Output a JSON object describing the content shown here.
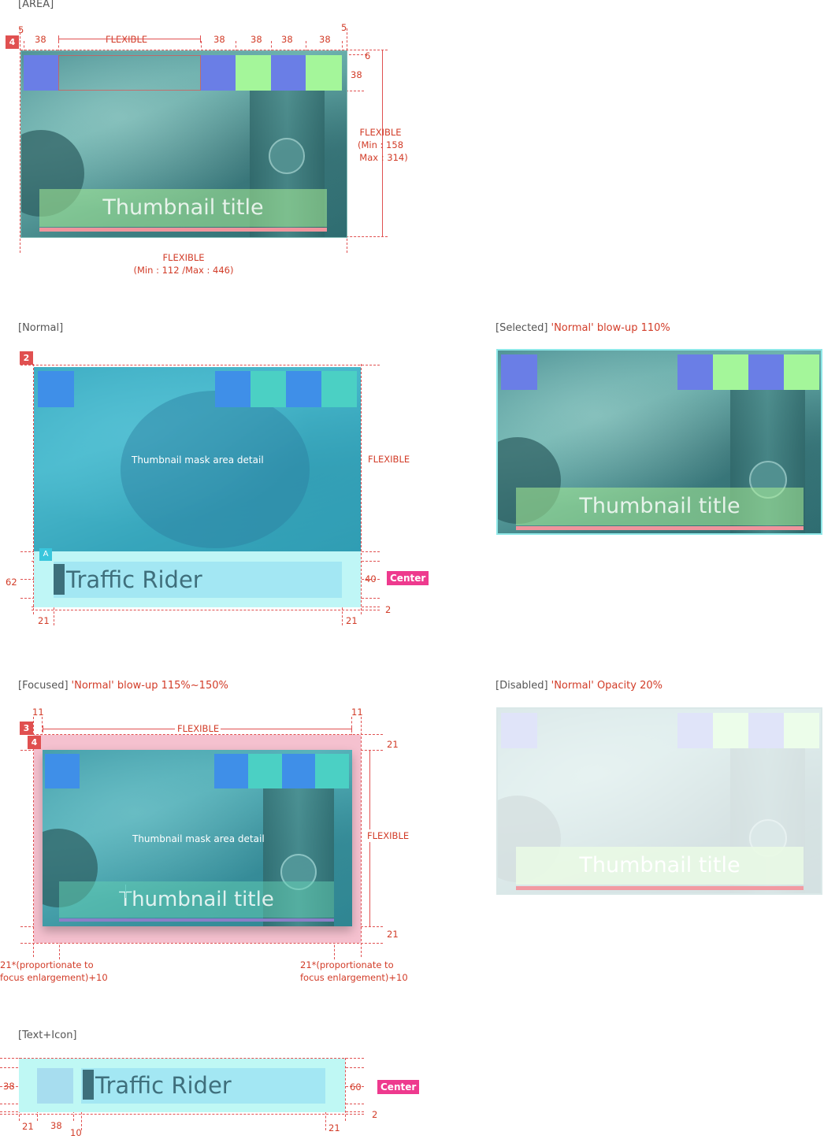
{
  "sections": {
    "area": {
      "label": "[AREA]"
    },
    "normal": {
      "label": "[Normal]"
    },
    "selected": {
      "label": "[Selected]",
      "note": "'Normal' blow-up 110%"
    },
    "focused": {
      "label": "[Focused]",
      "note": "'Normal' blow-up 115%~150%"
    },
    "disabled": {
      "label": "[Disabled]",
      "note": "'Normal' Opacity 20%"
    },
    "text_icon": {
      "label": "[Text+Icon]"
    }
  },
  "area": {
    "badge": "4",
    "top_dims": [
      "5",
      "38",
      "FLEXIBLE",
      "38",
      "38",
      "38",
      "38",
      "5"
    ],
    "right_dims": [
      "6",
      "38"
    ],
    "height_dim": [
      "FLEXIBLE",
      "(Min : 158",
      "Max : 314)"
    ],
    "width_dim": [
      "FLEXIBLE",
      "(Min : 112  /Max : 446)"
    ],
    "thumbnail_title": "Thumbnail title"
  },
  "normal": {
    "badge": "2",
    "badge_a": "A",
    "mask_text": "Thumbnail mask area detail",
    "flexible": "FLEXIBLE",
    "title": "Traffic Rider",
    "dim_left": "62",
    "dim_right": "40",
    "center_tag": "Center",
    "dim_bottom": "2",
    "dim_21_left": "21",
    "dim_21_right": "21"
  },
  "selected": {
    "thumbnail_title": "Thumbnail title"
  },
  "focused": {
    "badge_outer": "3",
    "badge_inner": "4",
    "dim_11_left": "11",
    "dim_11_right": "11",
    "flexible_top": "FLEXIBLE",
    "dim_21_top": "21",
    "flexible_right": "FLEXIBLE",
    "dim_21_bottom": "21",
    "mask_text": "Thumbnail mask area detail",
    "thumbnail_title": "Thumbnail title",
    "note_left": [
      "21*(proportionate  to",
      "focus enlargement)+10"
    ],
    "note_right": [
      "21*(proportionate  to",
      "focus enlargement)+10"
    ]
  },
  "disabled": {
    "thumbnail_title": "Thumbnail title"
  },
  "text_icon": {
    "title": "Traffic Rider",
    "dim_38_left": "38",
    "dim_60": "60",
    "center_tag": "Center",
    "dim_2": "2",
    "bottom_dims": [
      "21",
      "38",
      "10",
      "21"
    ]
  },
  "colors": {
    "dimension": "#d23c28",
    "icon_blue": "#6a7ee6",
    "icon_green": "#a4f69a",
    "normal_blue": "#3f8fe8",
    "normal_teal": "#4bd0c4",
    "center_tag": "#ee3a8e"
  }
}
